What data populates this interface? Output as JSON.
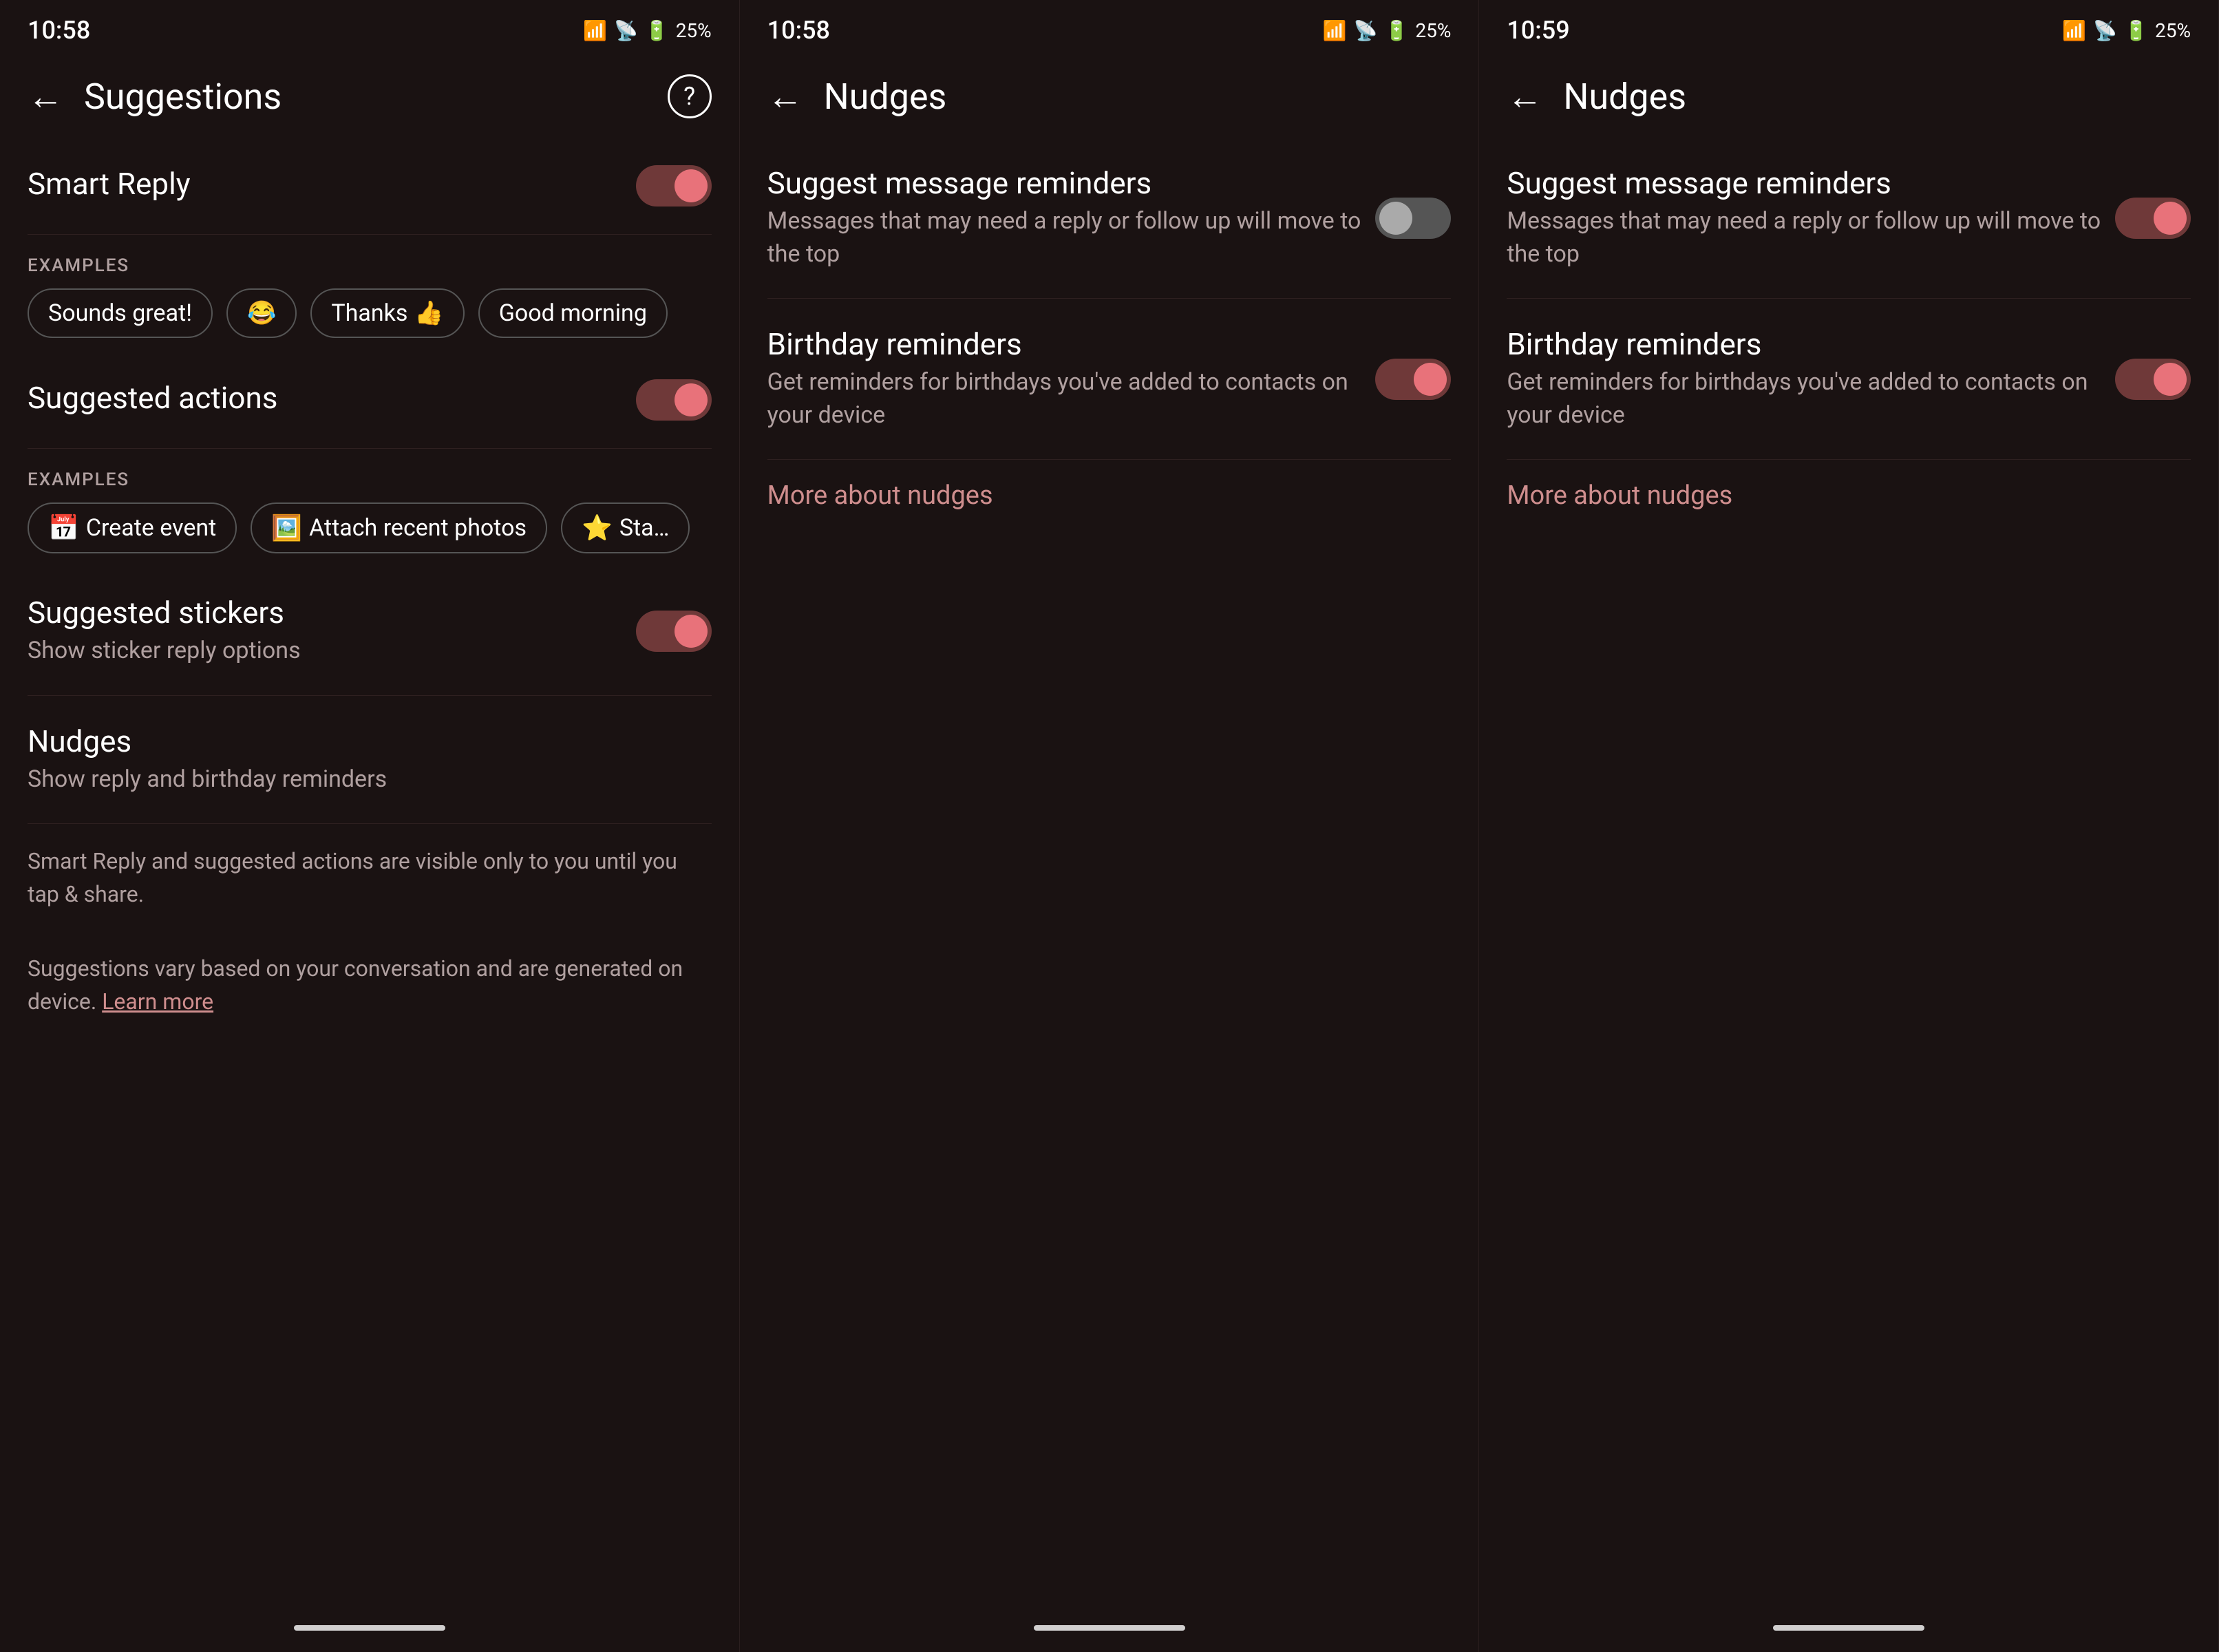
{
  "screens": [
    {
      "id": "suggestions",
      "statusBar": {
        "time": "10:58",
        "battery": "25%"
      },
      "topBar": {
        "backLabel": "←",
        "title": "Suggestions",
        "helpIcon": "?"
      },
      "sections": [
        {
          "id": "smart-reply",
          "title": "Smart Reply",
          "subtitle": "",
          "toggleOn": true,
          "showExamples": true,
          "examples": [
            {
              "icon": "",
              "label": "Sounds great!"
            },
            {
              "icon": "😂",
              "label": ""
            },
            {
              "icon": "👍",
              "label": "Thanks"
            },
            {
              "icon": "",
              "label": "Good morning"
            }
          ]
        },
        {
          "id": "suggested-actions",
          "title": "Suggested actions",
          "subtitle": "",
          "toggleOn": true,
          "showExamples": true,
          "examples": [
            {
              "icon": "📅",
              "label": "Create event"
            },
            {
              "icon": "🖼️",
              "label": "Attach recent photos"
            },
            {
              "icon": "⭐",
              "label": "Sta…"
            }
          ]
        },
        {
          "id": "suggested-stickers",
          "title": "Suggested stickers",
          "subtitle": "Show sticker reply options",
          "toggleOn": true,
          "showExamples": false
        },
        {
          "id": "nudges",
          "title": "Nudges",
          "subtitle": "Show reply and birthday reminders",
          "toggleOn": false,
          "showExamples": false,
          "isLink": true
        }
      ],
      "footerLines": [
        "Smart Reply and suggested actions are visible only to you until you tap & share.",
        "Suggestions vary based on your conversation and are generated on device."
      ],
      "learnMoreLabel": "Learn more"
    },
    {
      "id": "nudges-1",
      "statusBar": {
        "time": "10:58",
        "battery": "25%"
      },
      "topBar": {
        "backLabel": "←",
        "title": "Nudges"
      },
      "nudgeSettings": [
        {
          "id": "suggest-reminders-1",
          "title": "Suggest message reminders",
          "subtitle": "Messages that may need a reply or follow up will move to the top",
          "toggleOn": false
        },
        {
          "id": "birthday-reminders-1",
          "title": "Birthday reminders",
          "subtitle": "Get reminders for birthdays you've added to contacts on your device",
          "toggleOn": true
        }
      ],
      "moreLink": "More about nudges"
    },
    {
      "id": "nudges-2",
      "statusBar": {
        "time": "10:59",
        "battery": "25%"
      },
      "topBar": {
        "backLabel": "←",
        "title": "Nudges"
      },
      "nudgeSettings": [
        {
          "id": "suggest-reminders-2",
          "title": "Suggest message reminders",
          "subtitle": "Messages that may need a reply or follow up will move to the top",
          "toggleOn": true
        },
        {
          "id": "birthday-reminders-2",
          "title": "Birthday reminders",
          "subtitle": "Get reminders for birthdays you've added to contacts on your device",
          "toggleOn": true
        }
      ],
      "moreLink": "More about nudges"
    }
  ]
}
